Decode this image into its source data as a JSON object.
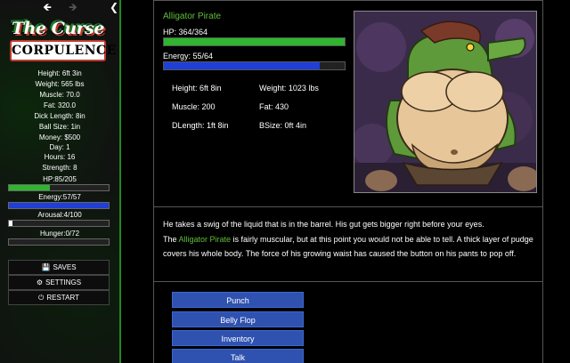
{
  "nav": {
    "back_icon": "arrow-left-icon",
    "forward_icon": "arrow-right-icon",
    "collapse_icon": "chevron-left-icon"
  },
  "logo": {
    "line1": "The Curse",
    "line2": "CORPULENCE"
  },
  "player_stats": [
    "Height: 6ft 3in",
    "Weight: 565 lbs",
    "Muscle: 70.0",
    "Fat: 320.0",
    "Dick Length: 8in",
    "Ball Size: 1in",
    "Money: $500",
    "Day: 1",
    "Hours: 16",
    "Strength: 8"
  ],
  "player_bars": {
    "hp": {
      "label": "HP:85/205",
      "fraction": 0.41,
      "color": "#2fb52f"
    },
    "energy": {
      "label": "Energy:57/57",
      "fraction": 1.0,
      "color": "#1f3fd6"
    },
    "arousal": {
      "label": "Arousal:4/100",
      "fraction": 0.04,
      "color": "#ffffff"
    },
    "hunger": {
      "label": "Hunger:0/72",
      "fraction": 0.0,
      "color": "#d69a1f"
    }
  },
  "menu": {
    "saves": "SAVES",
    "settings": "SETTINGS",
    "restart": "RESTART"
  },
  "enemy": {
    "name": "Alligator Pirate",
    "hp_label": "HP: 364/364",
    "hp_fraction": 1.0,
    "energy_label": "Energy: 55/64",
    "energy_fraction": 0.86,
    "stats": {
      "height": "Height: 6ft 8in",
      "weight": "Weight: 1023 lbs",
      "muscle": "Muscle: 200",
      "fat": "Fat: 430",
      "dlength": "DLength: 1ft 8in",
      "bsize": "BSize: 0ft 4in"
    }
  },
  "narration": {
    "line1": "He takes a swig of the liquid that is in the barrel. His gut gets bigger right before your eyes.",
    "line2_prefix": "The ",
    "line2_name": "Alligator Pirate",
    "line2_rest": " is fairly muscular, but at this point you would not be able to tell. A thick layer of pudge covers his whole body. The force of his growing waist has caused the button on his pants to pop off."
  },
  "actions": [
    "Punch",
    "Belly Flop",
    "Inventory",
    "Talk"
  ],
  "colors": {
    "accent_green": "#5fbf3a",
    "button_blue": "#2f52b0",
    "hp_green": "#2fb52f",
    "energy_blue": "#1f3fd6"
  }
}
